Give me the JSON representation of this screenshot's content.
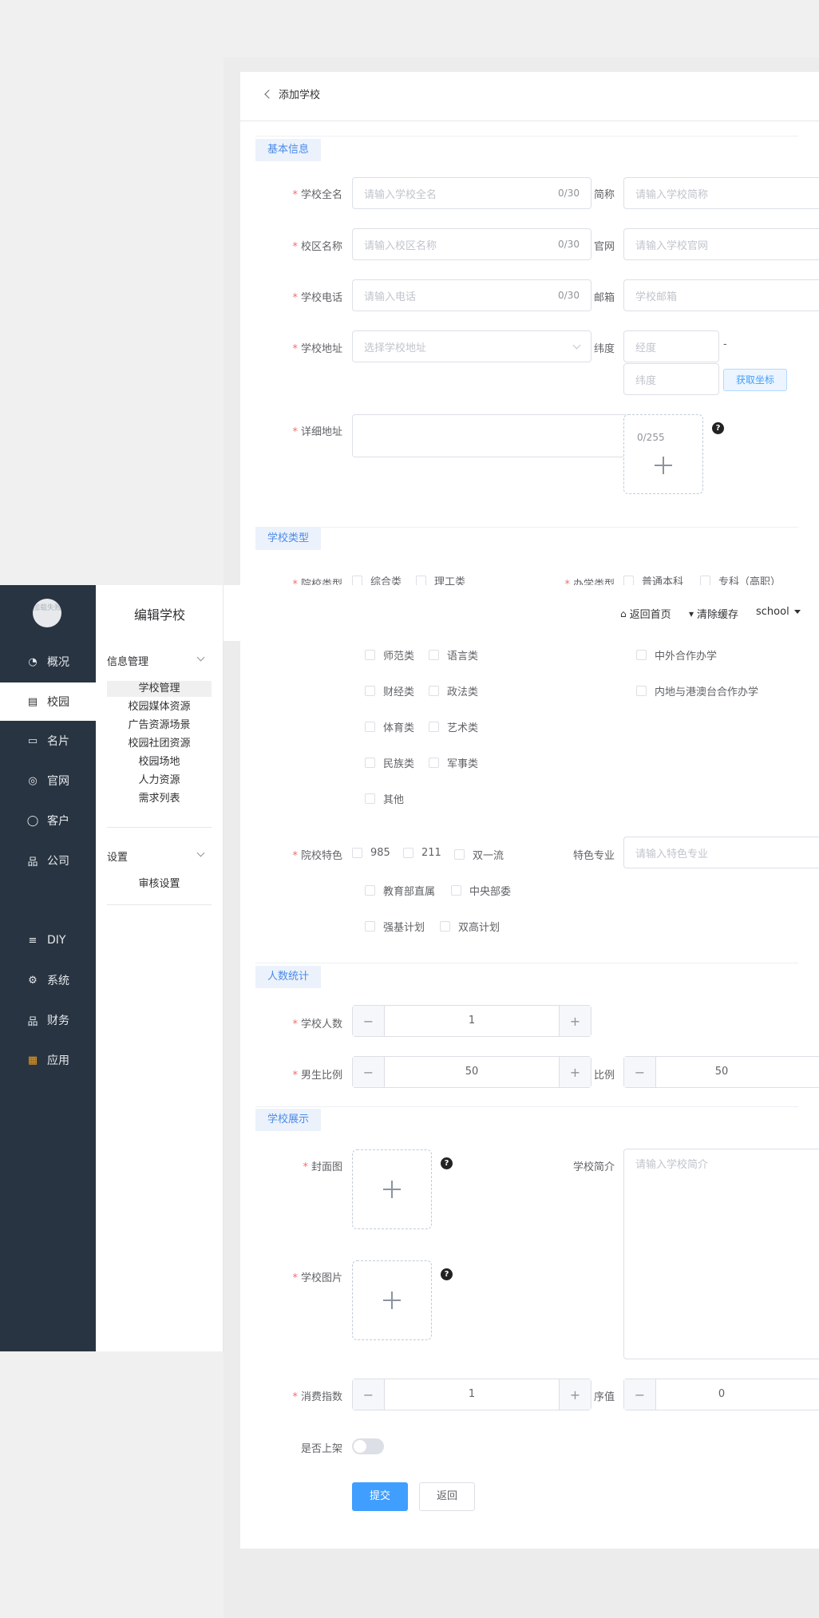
{
  "header": {
    "back_label": "添加学校"
  },
  "sections": {
    "basic": "基本信息",
    "type": "学校类型",
    "stats": "人数统计",
    "show": "学校展示"
  },
  "basic": {
    "full_name": {
      "label": "学校全名",
      "placeholder": "请输入学校全名",
      "count": "0/30"
    },
    "short_name": {
      "label": "简称",
      "placeholder": "请输入学校简称"
    },
    "campus": {
      "label": "校区名称",
      "placeholder": "请输入校区名称",
      "count": "0/30"
    },
    "website": {
      "label": "官网",
      "placeholder": "请输入学校官网"
    },
    "phone": {
      "label": "学校电话",
      "placeholder": "请输入电话",
      "count": "0/30"
    },
    "email": {
      "label": "邮箱",
      "placeholder": "学校邮箱"
    },
    "address": {
      "label": "学校地址",
      "placeholder": "选择学校地址"
    },
    "latitude": {
      "label": "纬度",
      "lng_placeholder": "经度",
      "lat_placeholder": "纬度",
      "dash": "-",
      "get_coords": "获取坐标"
    },
    "detail": {
      "label": "详细地址",
      "count": "0/255"
    }
  },
  "school_type": {
    "inst_label": "院校类型",
    "run_label": "办学类型",
    "inst_row1": [
      "综合类",
      "理工类"
    ],
    "run_row1": [
      "普通本科",
      "专科（高职）"
    ],
    "inst_row2": [
      "师范类",
      "语言类"
    ],
    "inst_row3": [
      "财经类",
      "政法类"
    ],
    "inst_row4": [
      "体育类",
      "艺术类"
    ],
    "inst_row5": [
      "民族类",
      "军事类"
    ],
    "inst_row6": [
      "其他"
    ],
    "run_row2": [
      "中外合作办学"
    ],
    "run_row3": [
      "内地与港澳台合作办学"
    ],
    "feature_label": "院校特色",
    "feature_row1": [
      "985",
      "211",
      "双一流"
    ],
    "feature_row2": [
      "教育部直属",
      "中央部委"
    ],
    "feature_row3": [
      "强基计划",
      "双高计划"
    ],
    "major_label": "特色专业",
    "major_placeholder": "请输入特色专业"
  },
  "stats": {
    "students": {
      "label": "学校人数",
      "value": "1"
    },
    "male_ratio": {
      "label": "男生比例",
      "value": "50"
    },
    "ratio": {
      "label": "比例",
      "value": "50"
    }
  },
  "show": {
    "cover_label": "封面图",
    "intro_label": "学校简介",
    "intro_placeholder": "请输入学校简介",
    "images_label": "学校图片",
    "consume": {
      "label": "消费指数",
      "value": "1"
    },
    "sort": {
      "label": "序值",
      "value": "0"
    },
    "publish_label": "是否上架",
    "submit": "提交",
    "back": "返回"
  },
  "sidebar": {
    "avatar_text": "加载失败",
    "items": [
      {
        "label": "概况",
        "icon": "pie-chart-icon",
        "glyph": "◔"
      },
      {
        "label": "校园",
        "icon": "building-icon",
        "glyph": "▤"
      },
      {
        "label": "名片",
        "icon": "card-icon",
        "glyph": "▭"
      },
      {
        "label": "官网",
        "icon": "compass-icon",
        "glyph": "◎"
      },
      {
        "label": "客户",
        "icon": "user-icon",
        "glyph": "◯"
      },
      {
        "label": "公司",
        "icon": "org-icon",
        "glyph": "品"
      },
      {
        "label": "DIY",
        "icon": "diy-icon",
        "glyph": "≡"
      },
      {
        "label": "系统",
        "icon": "gear-icon",
        "glyph": "⚙"
      },
      {
        "label": "财务",
        "icon": "finance-icon",
        "glyph": "品"
      },
      {
        "label": "应用",
        "icon": "apps-icon",
        "glyph": "▦"
      }
    ]
  },
  "subnav": {
    "title": "编辑学校",
    "group1": "信息管理",
    "group1_items": [
      "学校管理",
      "校园媒体资源",
      "广告资源场景",
      "校园社团资源",
      "校园场地",
      "人力资源",
      "需求列表"
    ],
    "group2": "设置",
    "group2_items": [
      "审核设置"
    ]
  },
  "topbar": {
    "home": "返回首页",
    "clear_cache": "清除缓存",
    "user": "school"
  }
}
